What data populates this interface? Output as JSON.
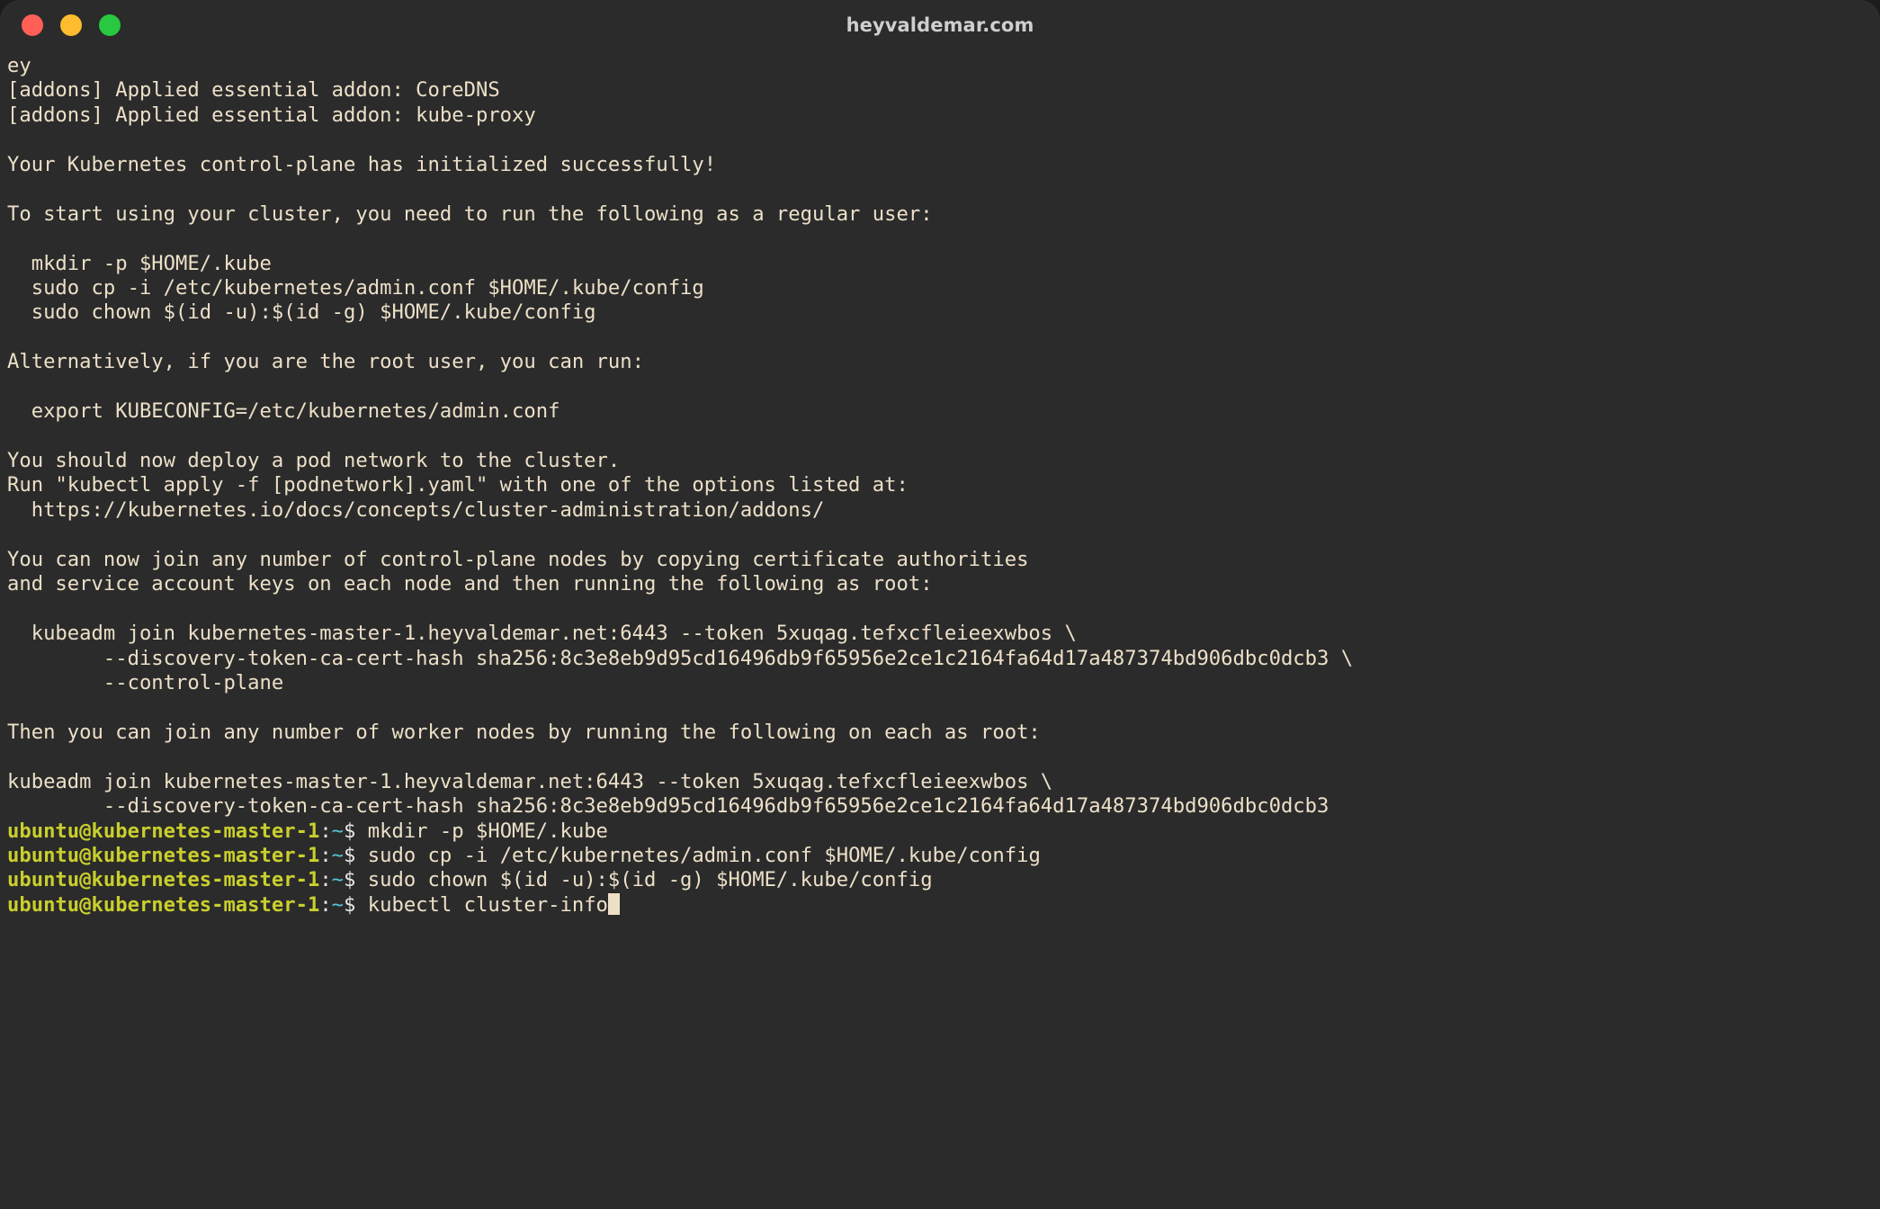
{
  "window": {
    "title": "heyvaldemar.com",
    "controls": [
      {
        "name": "close",
        "color": "#ff5f57"
      },
      {
        "name": "minimize",
        "color": "#febc2e"
      },
      {
        "name": "maximize",
        "color": "#28c840"
      }
    ],
    "background": "#2b2b2b",
    "text_color": "#ede0c8"
  },
  "prompt": {
    "user_host": "ubuntu@kubernetes-master-1",
    "colon": ":",
    "path": "~",
    "dollar": "$",
    "user_host_color": "#c9cf2c",
    "path_color": "#52c7d4"
  },
  "terminal": {
    "output_lines": [
      "ey",
      "[addons] Applied essential addon: CoreDNS",
      "[addons] Applied essential addon: kube-proxy",
      "",
      "Your Kubernetes control-plane has initialized successfully!",
      "",
      "To start using your cluster, you need to run the following as a regular user:",
      "",
      "  mkdir -p $HOME/.kube",
      "  sudo cp -i /etc/kubernetes/admin.conf $HOME/.kube/config",
      "  sudo chown $(id -u):$(id -g) $HOME/.kube/config",
      "",
      "Alternatively, if you are the root user, you can run:",
      "",
      "  export KUBECONFIG=/etc/kubernetes/admin.conf",
      "",
      "You should now deploy a pod network to the cluster.",
      "Run \"kubectl apply -f [podnetwork].yaml\" with one of the options listed at:",
      "  https://kubernetes.io/docs/concepts/cluster-administration/addons/",
      "",
      "You can now join any number of control-plane nodes by copying certificate authorities",
      "and service account keys on each node and then running the following as root:",
      "",
      "  kubeadm join kubernetes-master-1.heyvaldemar.net:6443 --token 5xuqag.tefxcfleieexwbos \\",
      "        --discovery-token-ca-cert-hash sha256:8c3e8eb9d95cd16496db9f65956e2ce1c2164fa64d17a487374bd906dbc0dcb3 \\",
      "        --control-plane",
      "",
      "Then you can join any number of worker nodes by running the following on each as root:",
      "",
      "kubeadm join kubernetes-master-1.heyvaldemar.net:6443 --token 5xuqag.tefxcfleieexwbos \\",
      "        --discovery-token-ca-cert-hash sha256:8c3e8eb9d95cd16496db9f65956e2ce1c2164fa64d17a487374bd906dbc0dcb3"
    ],
    "command_lines": [
      {
        "command": "mkdir -p $HOME/.kube",
        "cursor": false
      },
      {
        "command": "sudo cp -i /etc/kubernetes/admin.conf $HOME/.kube/config",
        "cursor": false
      },
      {
        "command": "sudo chown $(id -u):$(id -g) $HOME/.kube/config",
        "cursor": false
      },
      {
        "command": "kubectl cluster-info",
        "cursor": true
      }
    ]
  }
}
